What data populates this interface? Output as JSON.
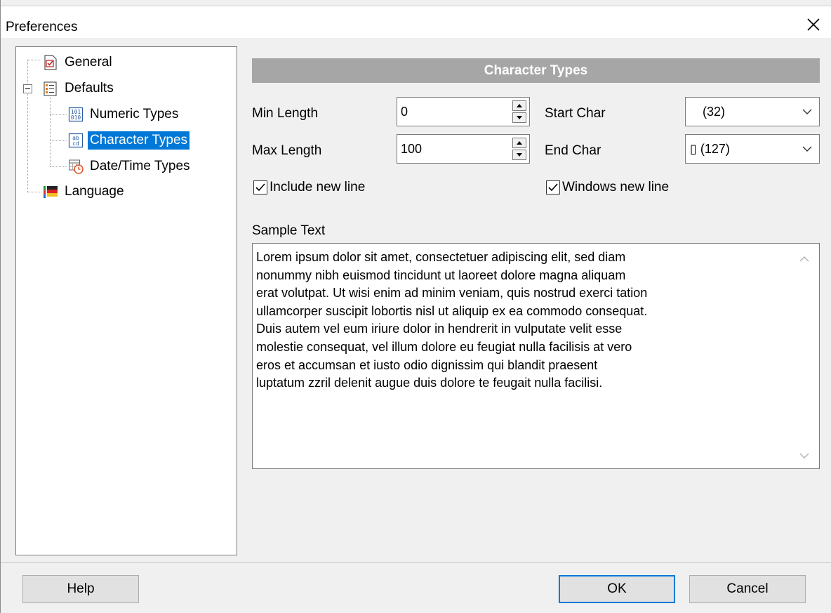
{
  "window": {
    "title": "Preferences",
    "close_icon": "close-icon"
  },
  "tree": {
    "items": [
      {
        "label": "General",
        "icon": "general-page-icon"
      },
      {
        "label": "Defaults",
        "icon": "defaults-list-icon"
      },
      {
        "label": "Numeric Types",
        "icon": "numeric-types-icon"
      },
      {
        "label": "Character Types",
        "icon": "character-types-icon",
        "selected": true
      },
      {
        "label": "Date/Time Types",
        "icon": "datetime-types-icon"
      },
      {
        "label": "Language",
        "icon": "language-flag-icon"
      }
    ]
  },
  "panel": {
    "header": "Character Types",
    "min_length": {
      "label": "Min Length",
      "value": "0"
    },
    "max_length": {
      "label": "Max Length",
      "value": "100"
    },
    "start_char": {
      "label": "Start Char",
      "value": "(32)"
    },
    "end_char": {
      "label": "End Char",
      "value": "▯ (127)"
    },
    "include_new_line": {
      "label": "Include new line",
      "checked": true
    },
    "windows_new_line": {
      "label": "Windows new line",
      "checked": true
    },
    "sample_text": {
      "label": "Sample Text",
      "lines": [
        "Lorem ipsum dolor sit amet, consectetuer adipiscing elit, sed diam",
        "nonummy nibh euismod tincidunt ut laoreet dolore magna aliquam",
        "erat volutpat. Ut wisi enim ad minim veniam, quis nostrud exerci tation",
        "ullamcorper suscipit lobortis nisl ut aliquip ex ea commodo consequat.",
        "Duis autem vel eum iriure dolor in hendrerit in vulputate velit esse",
        "molestie consequat, vel illum dolore eu feugiat nulla facilisis at vero",
        "eros et accumsan et iusto odio dignissim qui blandit praesent",
        "luptatum zzril delenit augue duis dolore te feugait nulla facilisi."
      ]
    }
  },
  "buttons": {
    "help": "Help",
    "ok": "OK",
    "cancel": "Cancel"
  },
  "colors": {
    "selection": "#0078d7",
    "header_bar": "#a6a6a6",
    "dialog_bg": "#f0f0f0"
  }
}
